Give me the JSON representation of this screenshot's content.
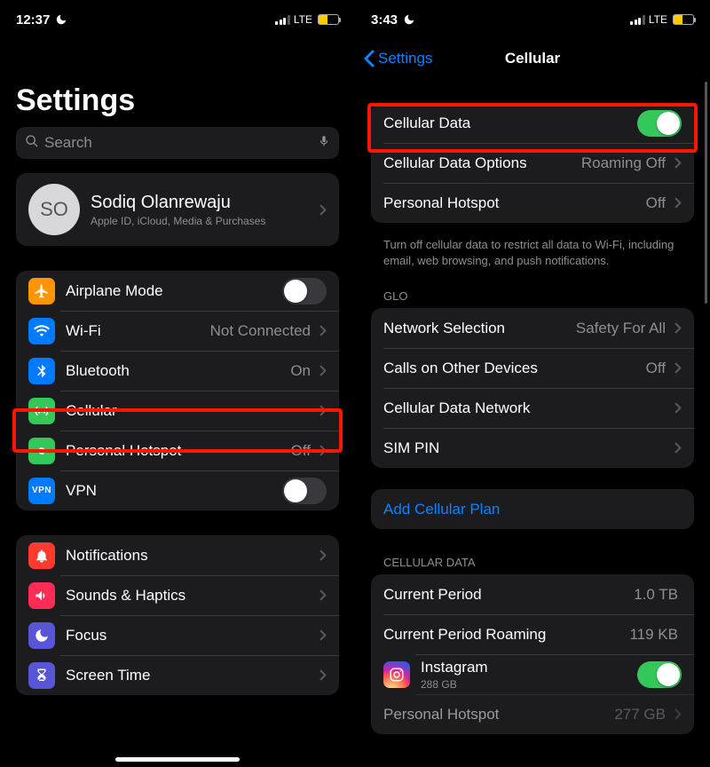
{
  "screen1": {
    "status": {
      "time": "12:37",
      "network_label": "LTE"
    },
    "title": "Settings",
    "search_placeholder": "Search",
    "profile": {
      "initials": "SO",
      "name": "Sodiq Olanrewaju",
      "subtitle": "Apple ID, iCloud, Media & Purchases"
    },
    "group1": {
      "airplane": "Airplane Mode",
      "wifi": "Wi-Fi",
      "wifi_value": "Not Connected",
      "bluetooth": "Bluetooth",
      "bluetooth_value": "On",
      "cellular": "Cellular",
      "hotspot": "Personal Hotspot",
      "hotspot_value": "Off",
      "vpn": "VPN",
      "vpn_icon_text": "VPN"
    },
    "group2": {
      "notifications": "Notifications",
      "sounds": "Sounds & Haptics",
      "focus": "Focus",
      "screentime": "Screen Time"
    }
  },
  "screen2": {
    "status": {
      "time": "3:43",
      "network_label": "LTE"
    },
    "nav": {
      "back": "Settings",
      "title": "Cellular"
    },
    "group1": {
      "cellular_data": "Cellular Data",
      "options": "Cellular Data Options",
      "options_value": "Roaming Off",
      "hotspot": "Personal Hotspot",
      "hotspot_value": "Off"
    },
    "footer1": "Turn off cellular data to restrict all data to Wi-Fi, including email, web browsing, and push notifications.",
    "header2": "GLO",
    "group2": {
      "network_selection": "Network Selection",
      "network_selection_value": "Safety For All",
      "calls_other": "Calls on Other Devices",
      "calls_other_value": "Off",
      "cdn": "Cellular Data Network",
      "sim_pin": "SIM PIN"
    },
    "add_plan": "Add Cellular Plan",
    "header3": "CELLULAR DATA",
    "group3": {
      "current_period": "Current Period",
      "current_period_value": "1.0 TB",
      "roaming": "Current Period Roaming",
      "roaming_value": "119 KB",
      "instagram": "Instagram",
      "instagram_sub": "288 GB",
      "personal_hotspot": "Personal Hotspot",
      "personal_hotspot_value": "277 GB"
    }
  }
}
